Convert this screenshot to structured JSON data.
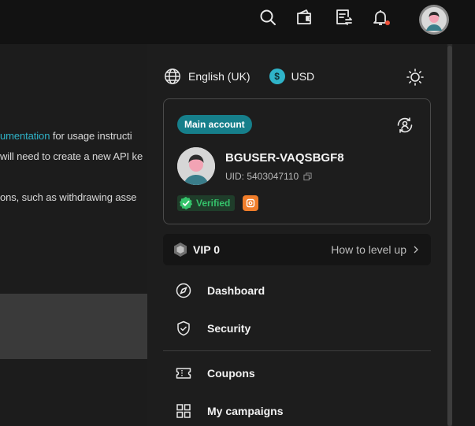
{
  "background_page": {
    "line1_link": "umentation",
    "line1_rest": " for usage instructi",
    "line2": "will need to create a new API ke",
    "line3": "ons, such as withdrawing asse"
  },
  "topbar": {
    "icons": [
      "search-icon",
      "wallet-icon",
      "orders-icon",
      "bell-icon",
      "avatar"
    ],
    "notification_dot_color": "#f0523a"
  },
  "settings": {
    "language": "English (UK)",
    "currency_symbol": "$",
    "currency": "USD"
  },
  "account": {
    "badge": "Main account",
    "username": "BGUSER-VAQSBGF8",
    "uid": "UID: 5403047110",
    "verified": "Verified"
  },
  "vip": {
    "level": "VIP 0",
    "link": "How to level up"
  },
  "menu": [
    {
      "label": "Dashboard",
      "icon": "compass-icon"
    },
    {
      "label": "Security",
      "icon": "shield-check-icon"
    },
    {
      "label": "Coupons",
      "icon": "ticket-icon"
    },
    {
      "label": "My campaigns",
      "icon": "grid-icon"
    }
  ],
  "colors": {
    "accent": "#2fb3c8",
    "badge_teal": "#167f8b",
    "verified_green": "#35c36b",
    "orange": "#f07d2a"
  }
}
